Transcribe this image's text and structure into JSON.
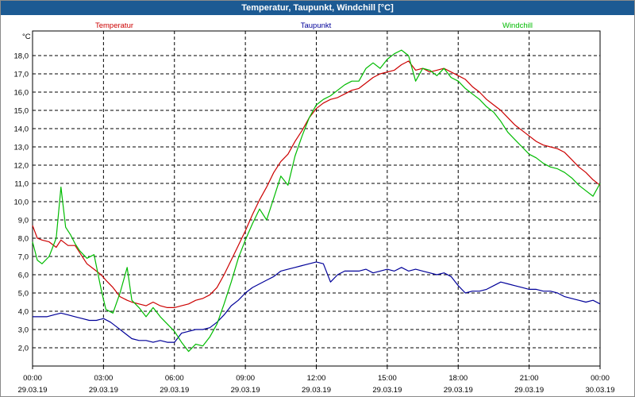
{
  "window": {
    "title": "Temperatur, Taupunkt, Windchill [°C]"
  },
  "chart_data": {
    "type": "line",
    "title": "Temperatur, Taupunkt, Windchill [°C]",
    "ylabel": "°C",
    "xlabel": "",
    "ylim": [
      1.2,
      19.5
    ],
    "xlim": [
      0,
      24
    ],
    "grid": true,
    "legend": "top",
    "yticks": [
      2.0,
      3.0,
      4.0,
      5.0,
      6.0,
      7.0,
      8.0,
      9.0,
      10.0,
      11.0,
      12.0,
      13.0,
      14.0,
      15.0,
      16.0,
      17.0,
      18.0
    ],
    "ytick_labels": [
      "2,0",
      "3,0",
      "4,0",
      "5,0",
      "6,0",
      "7,0",
      "8,0",
      "9,0",
      "10,0",
      "11,0",
      "12,0",
      "13,0",
      "14,0",
      "15,0",
      "16,0",
      "17,0",
      "18,0"
    ],
    "xticks": [
      0,
      3,
      6,
      9,
      12,
      15,
      18,
      21,
      24
    ],
    "xtick_times": [
      "00:00",
      "03:00",
      "06:00",
      "09:00",
      "12:00",
      "15:00",
      "18:00",
      "21:00",
      "00:00"
    ],
    "xtick_dates": [
      "29.03.19",
      "29.03.19",
      "29.03.19",
      "29.03.19",
      "29.03.19",
      "29.03.19",
      "29.03.19",
      "29.03.19",
      "30.03.19"
    ],
    "series": [
      {
        "name": "Temperatur",
        "color": "#cc0000",
        "x": [
          0,
          0.2,
          0.4,
          0.7,
          1.0,
          1.2,
          1.5,
          1.8,
          2.0,
          2.3,
          2.6,
          2.9,
          3.1,
          3.4,
          3.7,
          4.0,
          4.2,
          4.5,
          4.8,
          5.1,
          5.4,
          5.7,
          6.0,
          6.3,
          6.6,
          6.9,
          7.2,
          7.5,
          7.8,
          8.1,
          8.4,
          8.7,
          9.0,
          9.3,
          9.6,
          9.9,
          10.2,
          10.5,
          10.8,
          11.1,
          11.4,
          11.7,
          12.0,
          12.3,
          12.6,
          12.9,
          13.2,
          13.5,
          13.8,
          14.1,
          14.4,
          14.7,
          15.0,
          15.3,
          15.6,
          15.9,
          16.2,
          16.5,
          16.8,
          17.1,
          17.4,
          17.7,
          18.0,
          18.3,
          18.6,
          18.9,
          19.2,
          19.5,
          19.8,
          20.1,
          20.4,
          20.7,
          21.0,
          21.3,
          21.6,
          21.9,
          22.2,
          22.5,
          22.8,
          23.1,
          23.4,
          23.7,
          24.0
        ],
        "values": [
          8.7,
          8.0,
          7.9,
          7.8,
          7.5,
          7.9,
          7.6,
          7.6,
          7.2,
          6.6,
          6.3,
          6.0,
          5.7,
          5.3,
          4.8,
          4.6,
          4.5,
          4.4,
          4.3,
          4.5,
          4.3,
          4.2,
          4.2,
          4.3,
          4.4,
          4.6,
          4.7,
          4.9,
          5.3,
          6.0,
          6.8,
          7.6,
          8.4,
          9.3,
          10.1,
          10.8,
          11.6,
          12.2,
          12.6,
          13.3,
          13.9,
          14.6,
          15.1,
          15.4,
          15.6,
          15.7,
          15.9,
          16.1,
          16.2,
          16.5,
          16.8,
          17.0,
          17.1,
          17.2,
          17.5,
          17.7,
          17.2,
          17.3,
          17.1,
          17.2,
          17.3,
          17.1,
          16.9,
          16.7,
          16.3,
          16.0,
          15.6,
          15.3,
          15.0,
          14.6,
          14.2,
          13.9,
          13.6,
          13.3,
          13.1,
          13.0,
          12.9,
          12.7,
          12.3,
          11.9,
          11.6,
          11.2,
          10.9
        ]
      },
      {
        "name": "Taupunkt",
        "color": "#000099",
        "x": [
          0,
          0.3,
          0.6,
          0.9,
          1.2,
          1.5,
          1.8,
          2.1,
          2.4,
          2.7,
          3.0,
          3.3,
          3.6,
          3.9,
          4.2,
          4.5,
          4.8,
          5.1,
          5.4,
          5.7,
          6.0,
          6.3,
          6.6,
          6.9,
          7.2,
          7.5,
          7.8,
          8.1,
          8.4,
          8.7,
          9.0,
          9.3,
          9.6,
          9.9,
          10.2,
          10.5,
          10.8,
          11.1,
          11.4,
          11.7,
          12.0,
          12.3,
          12.6,
          12.9,
          13.2,
          13.5,
          13.8,
          14.1,
          14.4,
          14.7,
          15.0,
          15.3,
          15.6,
          15.9,
          16.2,
          16.5,
          16.8,
          17.1,
          17.4,
          17.7,
          18.0,
          18.3,
          18.6,
          18.9,
          19.2,
          19.5,
          19.8,
          20.1,
          20.4,
          20.7,
          21.0,
          21.3,
          21.6,
          21.9,
          22.2,
          22.5,
          22.8,
          23.1,
          23.4,
          23.7,
          24.0
        ],
        "values": [
          3.7,
          3.7,
          3.7,
          3.8,
          3.9,
          3.8,
          3.7,
          3.6,
          3.5,
          3.5,
          3.6,
          3.4,
          3.1,
          2.8,
          2.5,
          2.4,
          2.4,
          2.3,
          2.4,
          2.3,
          2.3,
          2.8,
          2.9,
          3.0,
          3.0,
          3.1,
          3.4,
          3.8,
          4.3,
          4.6,
          5.0,
          5.3,
          5.5,
          5.7,
          5.9,
          6.2,
          6.3,
          6.4,
          6.5,
          6.6,
          6.7,
          6.6,
          5.6,
          6.0,
          6.2,
          6.2,
          6.2,
          6.3,
          6.1,
          6.2,
          6.3,
          6.2,
          6.4,
          6.2,
          6.3,
          6.2,
          6.1,
          6.0,
          6.1,
          5.9,
          5.4,
          5.0,
          5.1,
          5.1,
          5.2,
          5.4,
          5.6,
          5.5,
          5.4,
          5.3,
          5.2,
          5.2,
          5.1,
          5.1,
          5.0,
          4.8,
          4.7,
          4.6,
          4.5,
          4.6,
          4.4
        ]
      },
      {
        "name": "Windchill",
        "color": "#00bb00",
        "x": [
          0,
          0.2,
          0.4,
          0.7,
          1.0,
          1.2,
          1.4,
          1.6,
          1.8,
          2.0,
          2.3,
          2.6,
          2.9,
          3.1,
          3.4,
          3.7,
          4.0,
          4.2,
          4.5,
          4.8,
          5.1,
          5.4,
          5.7,
          6.0,
          6.3,
          6.6,
          6.9,
          7.2,
          7.5,
          7.8,
          8.1,
          8.4,
          8.7,
          9.0,
          9.3,
          9.6,
          9.9,
          10.2,
          10.5,
          10.8,
          11.1,
          11.4,
          11.7,
          12.0,
          12.3,
          12.6,
          12.9,
          13.2,
          13.5,
          13.8,
          14.1,
          14.4,
          14.7,
          15.0,
          15.3,
          15.6,
          15.9,
          16.2,
          16.5,
          16.8,
          17.1,
          17.4,
          17.7,
          18.0,
          18.3,
          18.6,
          18.9,
          19.2,
          19.5,
          19.8,
          20.1,
          20.4,
          20.7,
          21.0,
          21.3,
          21.6,
          21.9,
          22.2,
          22.5,
          22.8,
          23.1,
          23.4,
          23.7,
          24.0
        ],
        "values": [
          7.8,
          6.8,
          6.6,
          7.0,
          8.0,
          10.8,
          8.6,
          8.2,
          7.7,
          7.3,
          6.9,
          7.1,
          5.2,
          4.1,
          3.9,
          5.0,
          6.4,
          4.6,
          4.2,
          3.7,
          4.2,
          3.7,
          3.3,
          2.9,
          2.3,
          1.8,
          2.2,
          2.1,
          2.6,
          3.3,
          4.4,
          5.6,
          6.9,
          7.9,
          8.8,
          9.6,
          9.0,
          10.2,
          11.4,
          10.9,
          12.5,
          13.6,
          14.6,
          15.3,
          15.6,
          15.8,
          16.1,
          16.4,
          16.6,
          16.6,
          17.3,
          17.6,
          17.3,
          17.8,
          18.1,
          18.3,
          18.0,
          16.6,
          17.3,
          17.2,
          16.9,
          17.3,
          16.8,
          16.6,
          16.2,
          15.9,
          15.6,
          15.2,
          14.9,
          14.4,
          13.8,
          13.4,
          13.0,
          12.6,
          12.4,
          12.1,
          11.9,
          11.8,
          11.6,
          11.3,
          10.9,
          10.6,
          10.3,
          11.0
        ]
      }
    ]
  }
}
